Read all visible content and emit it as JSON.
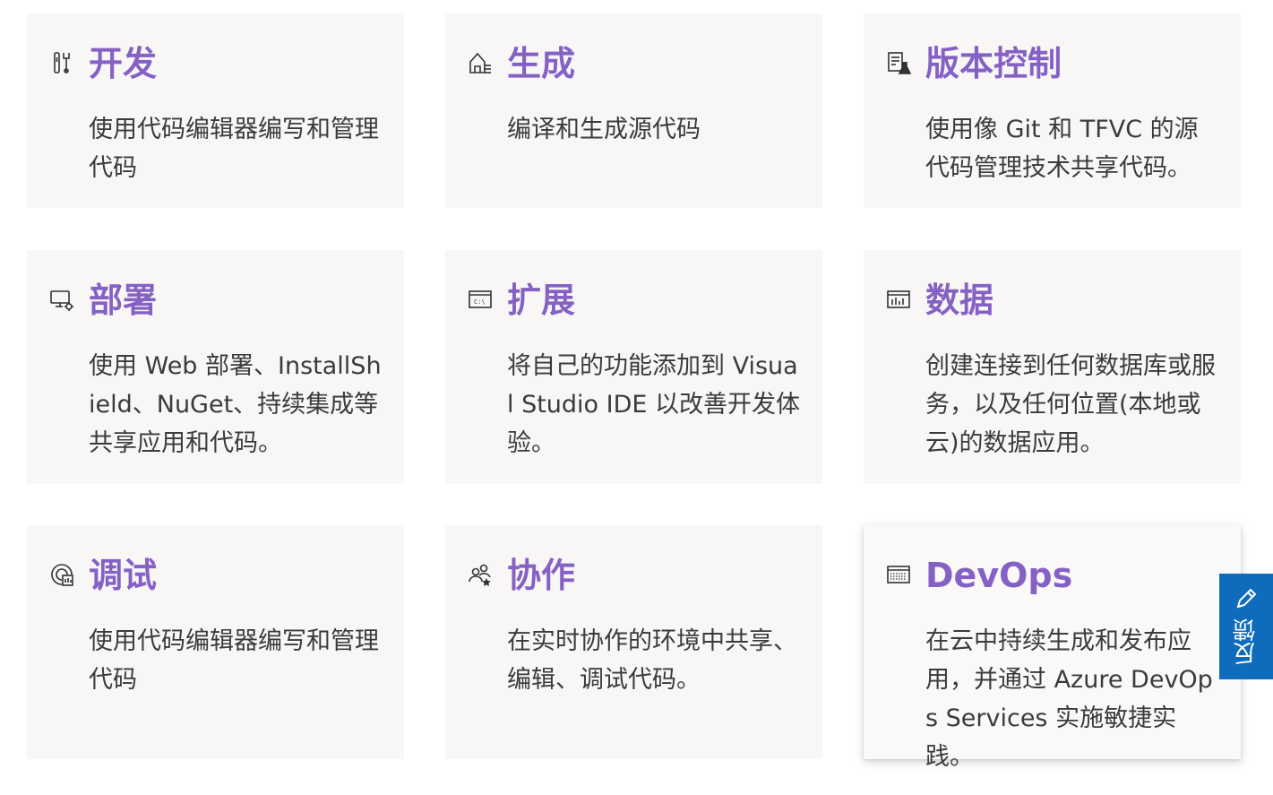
{
  "cards": [
    {
      "icon": "tools-icon",
      "title": "开发",
      "desc": "使用代码编辑器编写和管理代码"
    },
    {
      "icon": "build-icon",
      "title": "生成",
      "desc": "编译和生成源代码"
    },
    {
      "icon": "version-control-icon",
      "title": "版本控制",
      "desc": "使用像 Git 和 TFVC 的源代码管理技术共享代码。"
    },
    {
      "icon": "deploy-icon",
      "title": "部署",
      "desc": "使用 Web 部署、InstallShield、NuGet、持续集成等共享应用和代码。"
    },
    {
      "icon": "extend-icon",
      "title": "扩展",
      "desc": "将自己的功能添加到 Visual Studio IDE 以改善开发体验。"
    },
    {
      "icon": "data-icon",
      "title": "数据",
      "desc": "创建连接到任何数据库或服务，以及任何位置(本地或云)的数据应用。"
    },
    {
      "icon": "debug-icon",
      "title": "调试",
      "desc": "使用代码编辑器编写和管理代码"
    },
    {
      "icon": "collaborate-icon",
      "title": "协作",
      "desc": "在实时协作的环境中共享、编辑、调试代码。"
    },
    {
      "icon": "devops-icon",
      "title": "DevOps",
      "desc": "在云中持续生成和发布应用，并通过 Azure DevOps Services 实施敏捷实践。"
    }
  ],
  "feedback": {
    "label": "反馈",
    "icon": "pencil-icon"
  },
  "colors": {
    "accent": "#8661c5",
    "card_bg": "#f8f7f6",
    "feedback_bg": "#0f6cbd"
  }
}
